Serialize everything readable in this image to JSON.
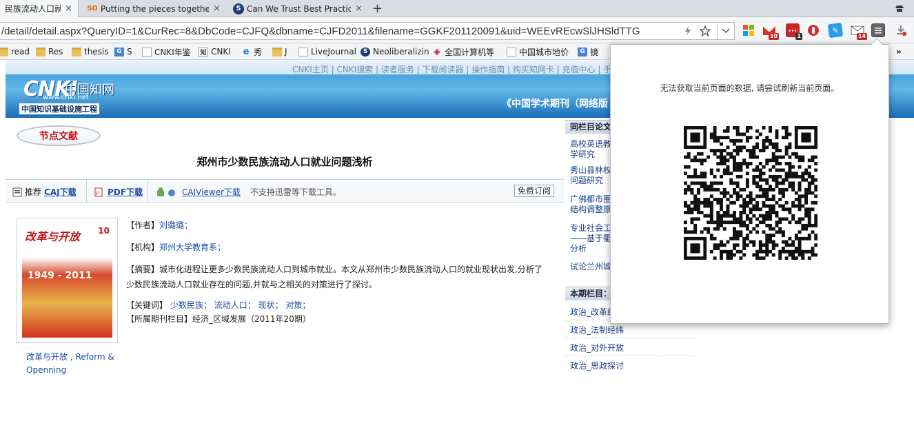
{
  "browser": {
    "tabs": [
      {
        "title": "民族流动人口就业",
        "favicon": "",
        "active": true
      },
      {
        "title": "Putting the pieces together: I",
        "favicon": "SD",
        "active": false
      },
      {
        "title": "Can We Trust Best Practices?",
        "favicon": "S",
        "active": false
      }
    ],
    "new_tab_label": "+",
    "close_label": "×",
    "url": "/detail/detail.aspx?QueryID=1&CurRec=8&DbCode=CJFQ&dbname=CJFD2011&filename=GGKF201120091&uid=WEEvREcwSlJHSldTTG",
    "extension_badges": {
      "gmail": "10",
      "ext2": "1",
      "mail": "14"
    },
    "bookmarks": [
      {
        "label": "read",
        "icon": "folder"
      },
      {
        "label": "Res",
        "icon": "folder"
      },
      {
        "label": "thesis",
        "icon": "folder"
      },
      {
        "label": "S",
        "icon": "google"
      },
      {
        "label": "CNKI年鉴",
        "icon": "doc"
      },
      {
        "label": "CNKI",
        "icon": "cnki"
      },
      {
        "label": "秀",
        "icon": "ie"
      },
      {
        "label": "J",
        "icon": "folder"
      },
      {
        "label": "LiveJournal",
        "icon": "doc"
      },
      {
        "label": "Neoliberalizin",
        "icon": "S"
      },
      {
        "label": "全国计算机等",
        "icon": "ncre"
      },
      {
        "label": "中国城市地价",
        "icon": "doc"
      },
      {
        "label": "镜",
        "icon": "google"
      }
    ],
    "more_label": "»"
  },
  "site": {
    "topnav": "CNKI主页 | CNKI搜索 | 读者服务 | 下载阅读器 | 操作指南 | 购买知网卡 | 充值中心 | 手机版",
    "logo_text": "CNKI",
    "logo_zh": "中国知网",
    "logo_url": "www.cnki.net",
    "logo_sub": "中国知识基础设施工程",
    "slogan": "《中国学术期刊（网络版"
  },
  "article": {
    "section_tag": "节点文献",
    "title": "郑州市少数民族流动人口就业问题浅析",
    "recommend_label": "推荐",
    "caj_download": "CAJ下载",
    "pdf_download": "PDF下载",
    "cajviewer_download": "CAJViewer下载",
    "no_thunder": "不支持迅雷等下载工具。",
    "subscribe": "免费订阅",
    "author_label": "【作者】",
    "author": "刘璐璐；",
    "org_label": "【机构】",
    "org": "郑州大学教育系；",
    "abstract_label": "【摘要】",
    "abstract": "城市化进程让更多少数民族流动人口到城市就业。本文从郑州市少数民族流动人口的就业现状出发,分析了少数民族流动人口就业存在的问题,并就与之相关的对策进行了探讨。",
    "keywords_label": "【关键词】",
    "keywords": [
      "少数民族；",
      "流动人口；",
      "现状；",
      "对策；"
    ],
    "column_label": "【所属期刊栏目】",
    "column": "经济_区域发展（2011年20期）",
    "cover_title": "改革与开放",
    "cover_issue": "10",
    "cover_year": "1949 - 2011",
    "journal_name": "改革与开放 , Reform & Openning"
  },
  "right_col": {
    "head1": "同栏目论文",
    "items1": [
      "高校英语教学研究",
      "秀山县林权问题研究",
      "广佛都市圈结构调整原",
      "专业社会工——基于衢分析",
      "试论兰州城"
    ],
    "head2": "本期栏目：",
    "items2": [
      "政治_改革经",
      "政治_法制经纬",
      "政治_对外开放",
      "政治_思政探讨"
    ]
  },
  "popup": {
    "message": "无法获取当前页面的数据, 请尝试刷新当前页面。"
  },
  "colors": {
    "link": "#1a4fa8",
    "section_red": "#c2151a"
  }
}
